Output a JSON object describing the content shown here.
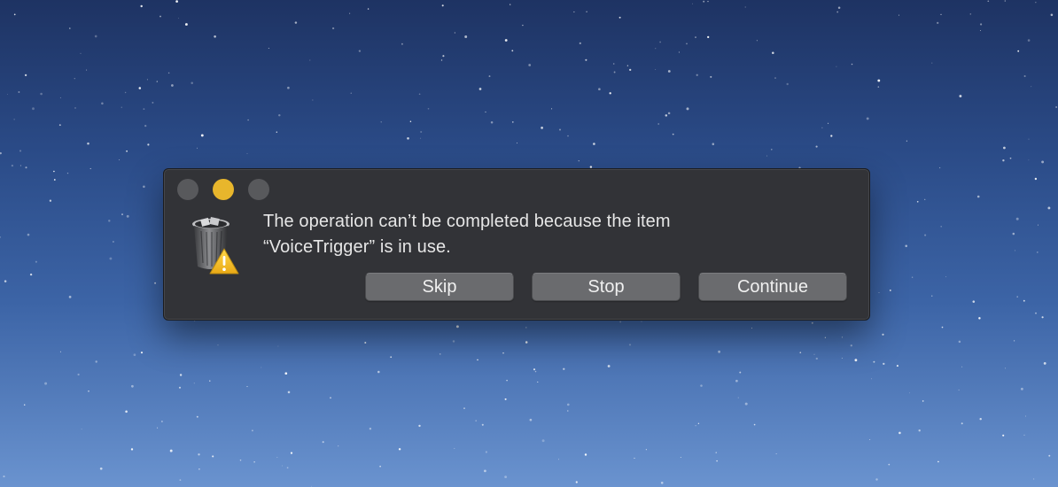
{
  "window": {
    "controls": {
      "close": "close-button",
      "minimize": "minimize-button",
      "zoom": "zoom-button"
    }
  },
  "alert": {
    "icon": "trash-warning-icon",
    "message_line1": "The operation can’t be completed because the item",
    "message_line2": "“VoiceTrigger” is in use.",
    "buttons": {
      "skip": "Skip",
      "stop": "Stop",
      "continue": "Continue"
    }
  },
  "colors": {
    "dialog_background": "#323337",
    "button_background": "#6a6b6e",
    "minimize_yellow": "#e8b62c",
    "inactive_control": "#58595c",
    "warning_yellow": "#f4c430",
    "text": "#e6e6e6"
  }
}
